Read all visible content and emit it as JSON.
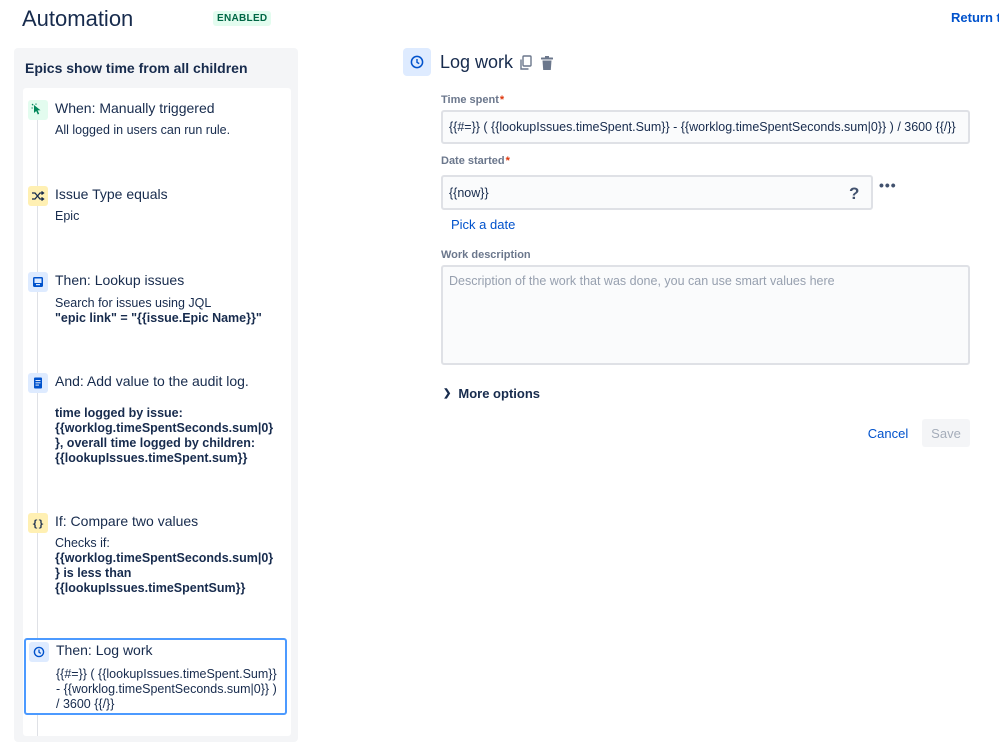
{
  "header": {
    "title": "Automation",
    "status": "ENABLED",
    "return_link": "Return to"
  },
  "rule": {
    "name": "Epics show time from all children",
    "components": [
      {
        "title": "When: Manually triggered",
        "lines": [
          "All logged in users can run rule."
        ],
        "icon": "cursor-click-icon",
        "color": "#e3fcef"
      },
      {
        "title": "Issue Type equals",
        "lines": [
          "Epic"
        ],
        "icon": "shuffle-icon",
        "color": "#fff0b3"
      },
      {
        "title": "Then: Lookup issues",
        "lines": [
          "Search for issues using JQL",
          "\"epic link\" = \"{{issue.Epic Name}}\""
        ],
        "icon": "inbox-icon",
        "color": "#deebff"
      },
      {
        "title": "And: Add value to the audit log.",
        "lines": [
          "time logged by issue:",
          "{{worklog.timeSpentSeconds.sum|0}",
          "}, overall time logged by children:",
          "{{lookupIssues.timeSpent.sum}}"
        ],
        "icon": "document-icon",
        "color": "#deebff"
      },
      {
        "title": "If: Compare two values",
        "lines": [
          "Checks if:",
          "{{worklog.timeSpentSeconds.sum|0}",
          "} is less than",
          "{{lookupIssues.timeSpentSum}}"
        ],
        "icon": "braces-icon",
        "color": "#fff0b3"
      },
      {
        "title": "Then: Log work",
        "lines": [
          "{{#=}} ( {{lookupIssues.timeSpent.Sum}}",
          "- {{worklog.timeSpentSeconds.sum|0}} )",
          "/ 3600 {{/}}"
        ],
        "icon": "clock-icon",
        "color": "#deebff"
      }
    ]
  },
  "editor": {
    "title": "Log work",
    "time_spent": {
      "label": "Time spent",
      "required_mark": "*",
      "value": "{{#=}} ( {{lookupIssues.timeSpent.Sum}} - {{worklog.timeSpentSeconds.sum|0}} ) / 3600 {{/}}"
    },
    "date_started": {
      "label": "Date started",
      "required_mark": "*",
      "value": "{{now}}",
      "help": "?",
      "more": "•••"
    },
    "pick_date": "Pick a date",
    "work_description": {
      "label": "Work description",
      "placeholder": "Description of the work that was done, you can use smart values here"
    },
    "more_options": "More options",
    "cancel": "Cancel",
    "save": "Save"
  }
}
